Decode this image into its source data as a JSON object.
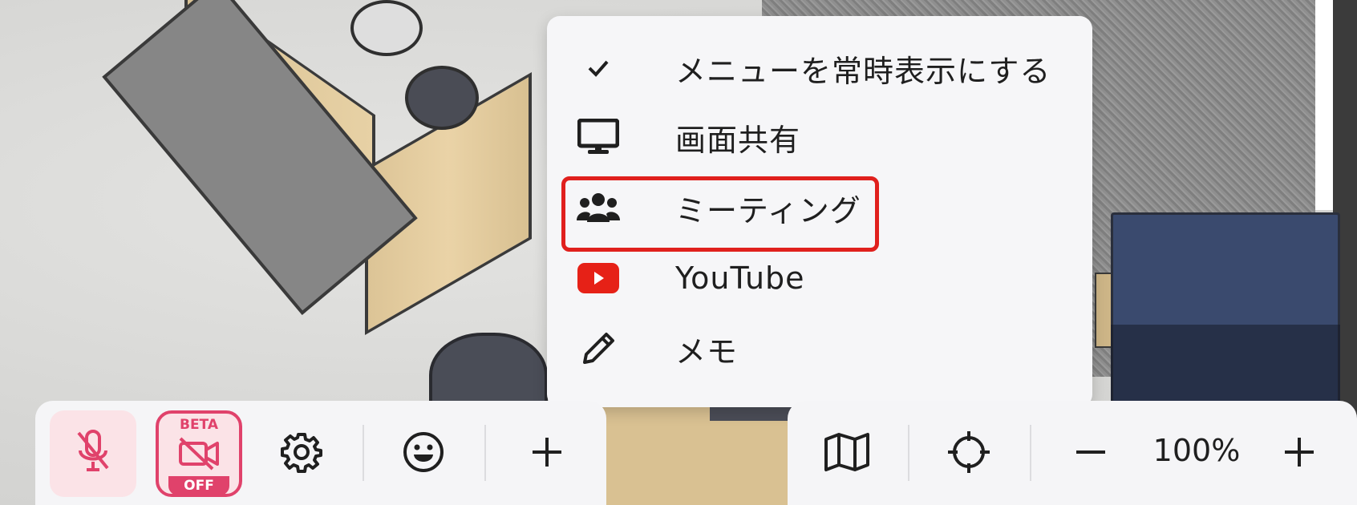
{
  "menu": {
    "items": [
      {
        "label": "メニューを常時表示にする",
        "icon": "checkmark-icon"
      },
      {
        "label": "画面共有",
        "icon": "monitor-icon"
      },
      {
        "label": "ミーティング",
        "icon": "users-icon"
      },
      {
        "label": "YouTube",
        "icon": "youtube-icon"
      },
      {
        "label": "メモ",
        "icon": "pencil-icon"
      }
    ],
    "highlighted_item": "ミーティング",
    "highlight_color": "#e0201d"
  },
  "toolbar_left": {
    "mic": {
      "icon": "microphone-muted-icon",
      "state": "muted"
    },
    "camera": {
      "icon": "camera-off-icon",
      "badge_top": "BETA",
      "badge_bottom": "OFF"
    },
    "settings": {
      "icon": "gear-icon"
    },
    "emoji": {
      "icon": "smiley-icon"
    },
    "add": {
      "icon": "plus-icon"
    }
  },
  "toolbar_right": {
    "map": {
      "icon": "map-icon"
    },
    "locate": {
      "icon": "crosshair-icon"
    },
    "zoom_out": {
      "icon": "minus-icon"
    },
    "zoom_level": "100%",
    "zoom_in": {
      "icon": "plus-icon"
    }
  },
  "colors": {
    "accent_pink": "#e0426b",
    "highlight_red": "#e0201d",
    "youtube_red": "#e62117"
  }
}
